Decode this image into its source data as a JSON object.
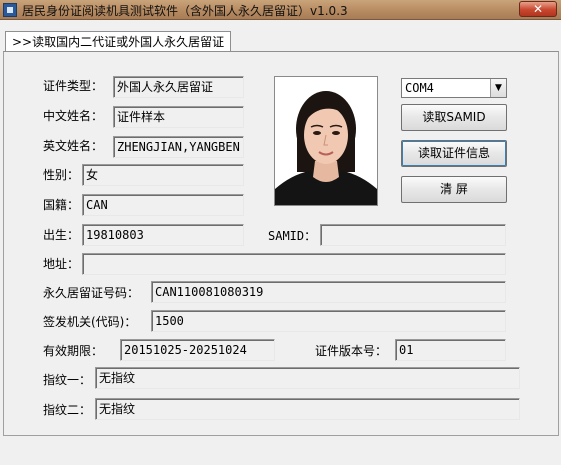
{
  "window": {
    "title": "居民身份证阅读机具测试软件（含外国人永久居留证）v1.0.3",
    "close_label": "✕"
  },
  "tab": {
    "label": ">>读取国内二代证或外国人永久居留证"
  },
  "form": {
    "cert_type": {
      "label": "证件类型：",
      "value": "外国人永久居留证"
    },
    "chinese_name": {
      "label": "中文姓名：",
      "value": "证件样本"
    },
    "english_name": {
      "label": "英文姓名：",
      "value": "ZHENGJIAN,YANGBEN"
    },
    "gender": {
      "label": "性别：",
      "value": "女"
    },
    "nationality": {
      "label": "国籍：",
      "value": "CAN"
    },
    "birth": {
      "label": "出生：",
      "value": "19810803"
    },
    "samid_field": {
      "label": "SAMID：",
      "value": ""
    },
    "address": {
      "label": "地址：",
      "value": ""
    },
    "permit_number": {
      "label": "永久居留证号码：",
      "value": "CAN110081080319"
    },
    "issuing_authority": {
      "label": "签发机关(代码)：",
      "value": "1500"
    },
    "validity": {
      "label": "有效期限：",
      "value": "20151025-20251024"
    },
    "version": {
      "label": "证件版本号：",
      "value": "01"
    },
    "fingerprint1": {
      "label": "指纹一：",
      "value": "无指纹"
    },
    "fingerprint2": {
      "label": "指纹二：",
      "value": "无指纹"
    }
  },
  "controls": {
    "port_select": {
      "value": "COM4"
    },
    "read_samid_button": "读取SAMID",
    "read_card_button": "读取证件信息",
    "clear_button": "清 屏"
  }
}
